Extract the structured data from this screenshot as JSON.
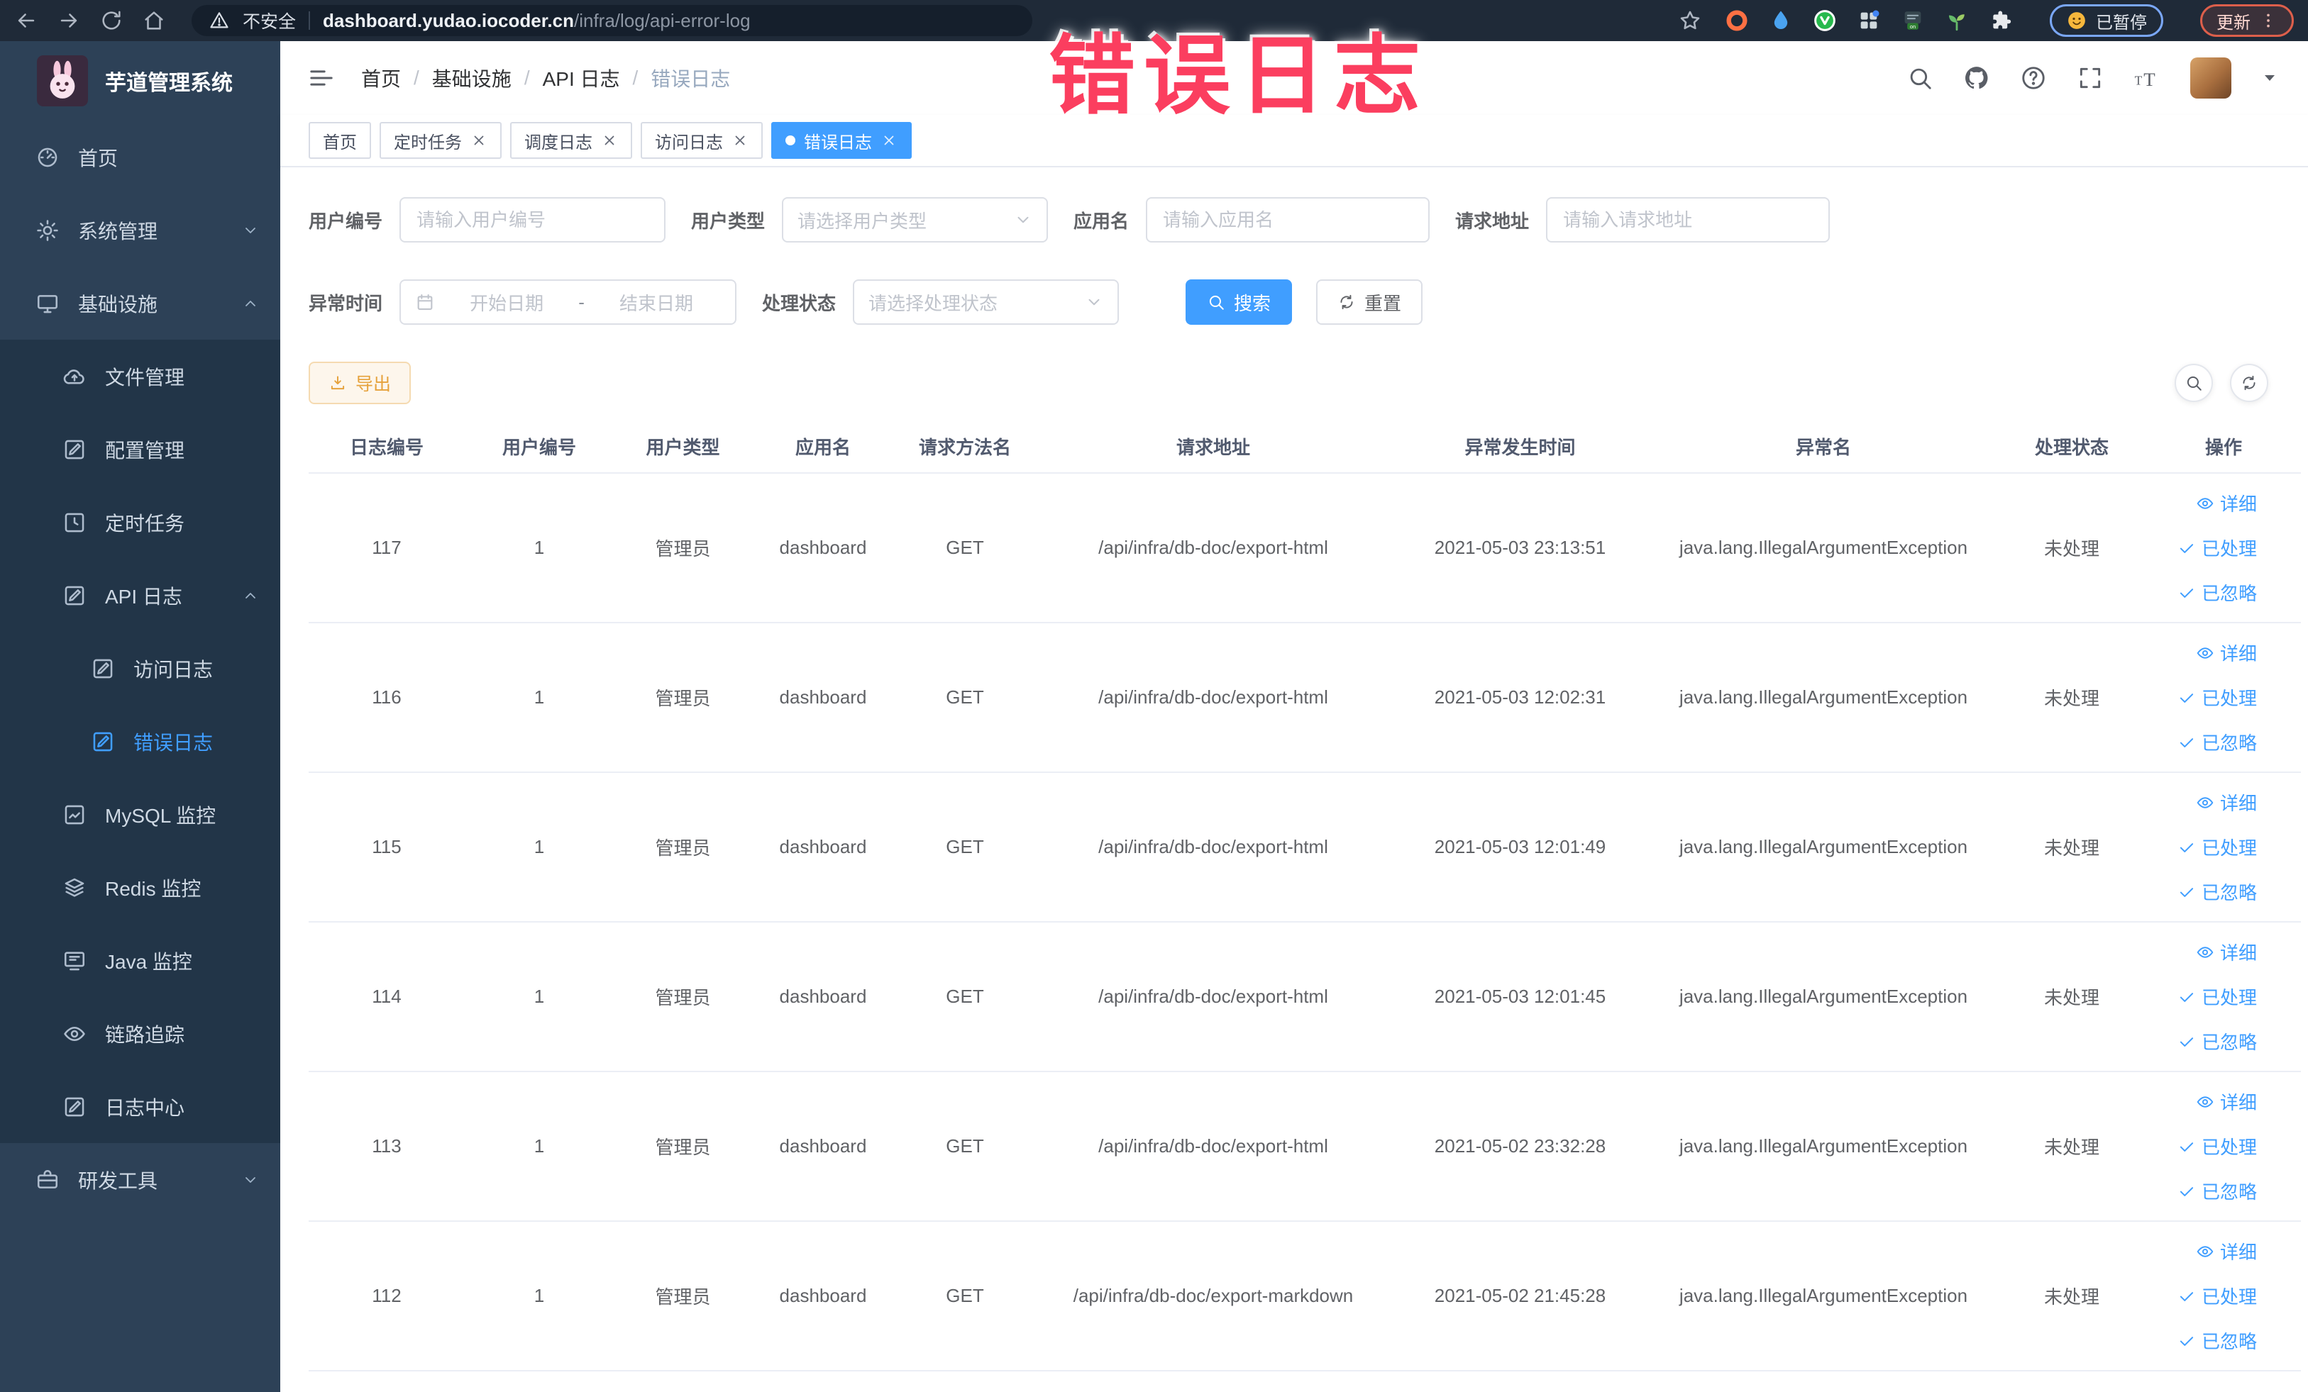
{
  "browser": {
    "security_label": "不安全",
    "url_host": "dashboard.yudao.iocoder.cn",
    "url_path": "/infra/log/api-error-log",
    "paused_button": "已暂停",
    "update_button": "更新",
    "extensions": [
      {
        "icon": "orange-ring"
      },
      {
        "icon": "blue-drop"
      },
      {
        "icon": "green-v"
      },
      {
        "icon": "grid-ext"
      },
      {
        "icon": "on-badge"
      },
      {
        "icon": "sprout"
      },
      {
        "icon": "puzzle"
      }
    ]
  },
  "annotation": {
    "text": "错误日志"
  },
  "sidebar": {
    "title": "芋道管理系统",
    "items": [
      {
        "label": "首页",
        "icon": "dashboard",
        "level": 1,
        "block": "top"
      },
      {
        "label": "系统管理",
        "icon": "gear",
        "level": 1,
        "block": "top",
        "arrow": "down"
      },
      {
        "label": "基础设施",
        "icon": "monitor",
        "level": 1,
        "block": "top",
        "arrow": "up"
      },
      {
        "label": "文件管理",
        "icon": "cloud-upload",
        "level": 2,
        "block": "sub"
      },
      {
        "label": "配置管理",
        "icon": "edit-square",
        "level": 2,
        "block": "sub"
      },
      {
        "label": "定时任务",
        "icon": "clock-square",
        "level": 2,
        "block": "sub"
      },
      {
        "label": "API 日志",
        "icon": "log-square",
        "level": 2,
        "block": "sub",
        "arrow": "up"
      },
      {
        "label": "访问日志",
        "icon": "log-square",
        "level": 3,
        "block": "sub"
      },
      {
        "label": "错误日志",
        "icon": "log-square",
        "level": 3,
        "block": "sub",
        "active": true
      },
      {
        "label": "MySQL 监控",
        "icon": "chart-square",
        "level": 2,
        "block": "sub"
      },
      {
        "label": "Redis 监控",
        "icon": "layers",
        "level": 2,
        "block": "sub"
      },
      {
        "label": "Java 监控",
        "icon": "java-monitor",
        "level": 2,
        "block": "sub"
      },
      {
        "label": "链路追踪",
        "icon": "eye",
        "level": 2,
        "block": "sub"
      },
      {
        "label": "日志中心",
        "icon": "log-square",
        "level": 2,
        "block": "sub"
      },
      {
        "label": "研发工具",
        "icon": "briefcase",
        "level": 1,
        "block": "bottom",
        "arrow": "down"
      }
    ]
  },
  "header": {
    "breadcrumb": [
      "首页",
      "基础设施",
      "API 日志",
      "错误日志"
    ]
  },
  "tabs": [
    {
      "label": "首页",
      "closable": false,
      "active": false
    },
    {
      "label": "定时任务",
      "closable": true,
      "active": false
    },
    {
      "label": "调度日志",
      "closable": true,
      "active": false
    },
    {
      "label": "访问日志",
      "closable": true,
      "active": false
    },
    {
      "label": "错误日志",
      "closable": true,
      "active": true
    }
  ],
  "filters": {
    "user_id": {
      "label": "用户编号",
      "placeholder": "请输入用户编号"
    },
    "user_type": {
      "label": "用户类型",
      "placeholder": "请选择用户类型"
    },
    "app_name": {
      "label": "应用名",
      "placeholder": "请输入应用名"
    },
    "request_url": {
      "label": "请求地址",
      "placeholder": "请输入请求地址"
    },
    "error_time": {
      "label": "异常时间",
      "start_placeholder": "开始日期",
      "separator": "-",
      "end_placeholder": "结束日期"
    },
    "process_status": {
      "label": "处理状态",
      "placeholder": "请选择处理状态"
    },
    "search_button": "搜索",
    "reset_button": "重置"
  },
  "toolbar": {
    "export_label": "导出"
  },
  "table": {
    "headers": [
      "日志编号",
      "用户编号",
      "用户类型",
      "应用名",
      "请求方法名",
      "请求地址",
      "异常发生时间",
      "异常名",
      "处理状态",
      "操作"
    ],
    "cell_names": [
      "log-id",
      "user-id",
      "user-type",
      "app-name",
      "method",
      "request-url",
      "error-time",
      "exception-name",
      "status"
    ],
    "actions": [
      {
        "key": "detail",
        "label": "详细",
        "icon": "view"
      },
      {
        "key": "processed",
        "label": "已处理",
        "icon": "check"
      },
      {
        "key": "ignored",
        "label": "已忽略",
        "icon": "check"
      }
    ],
    "rows": [
      [
        "117",
        "1",
        "管理员",
        "dashboard",
        "GET",
        "/api/infra/db-doc/export-html",
        "2021-05-03 23:13:51",
        "java.lang.IllegalArgumentException",
        "未处理"
      ],
      [
        "116",
        "1",
        "管理员",
        "dashboard",
        "GET",
        "/api/infra/db-doc/export-html",
        "2021-05-03 12:02:31",
        "java.lang.IllegalArgumentException",
        "未处理"
      ],
      [
        "115",
        "1",
        "管理员",
        "dashboard",
        "GET",
        "/api/infra/db-doc/export-html",
        "2021-05-03 12:01:49",
        "java.lang.IllegalArgumentException",
        "未处理"
      ],
      [
        "114",
        "1",
        "管理员",
        "dashboard",
        "GET",
        "/api/infra/db-doc/export-html",
        "2021-05-03 12:01:45",
        "java.lang.IllegalArgumentException",
        "未处理"
      ],
      [
        "113",
        "1",
        "管理员",
        "dashboard",
        "GET",
        "/api/infra/db-doc/export-html",
        "2021-05-02 23:32:28",
        "java.lang.IllegalArgumentException",
        "未处理"
      ],
      [
        "112",
        "1",
        "管理员",
        "dashboard",
        "GET",
        "/api/infra/db-doc/export-markdown",
        "2021-05-02 21:45:28",
        "java.lang.IllegalArgumentException",
        "未处理"
      ]
    ]
  },
  "colors": {
    "accent": "#409eff",
    "annotation_pink": "#fb3e5f",
    "warning_text": "#e6a23c",
    "sidebar_bg": "#2d4157",
    "submenu_bg": "#223548"
  }
}
